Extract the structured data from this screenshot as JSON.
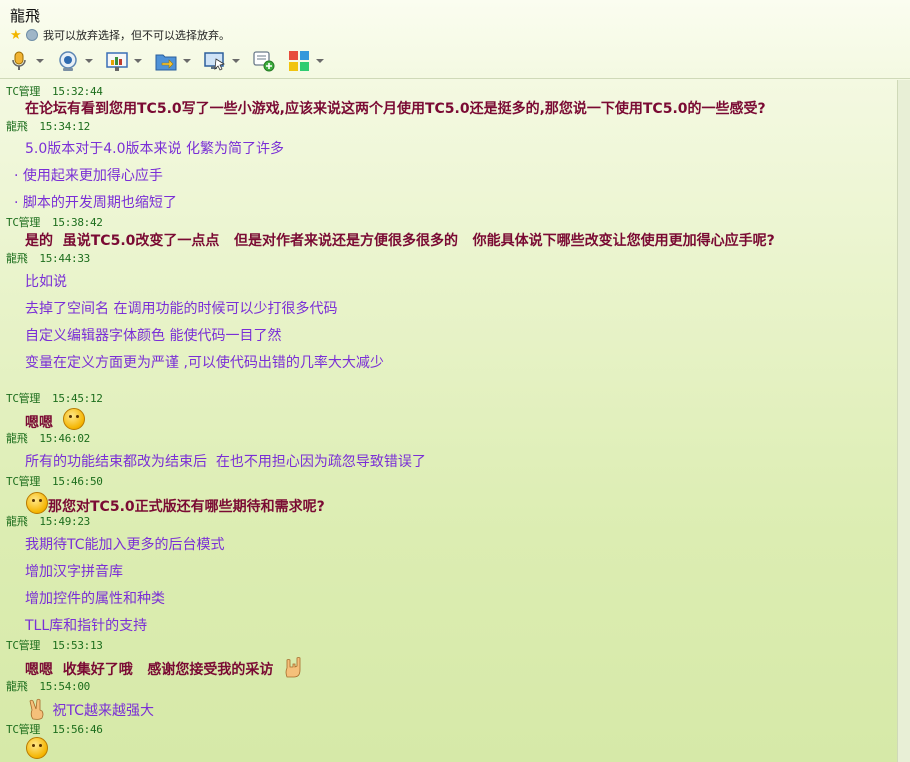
{
  "window": {
    "contact_name": "龍飛",
    "signature": "我可以放弃选择，但不可以选择放弃。"
  },
  "toolbar": {
    "items": [
      {
        "icon": "microphone-icon",
        "name": "voice"
      },
      {
        "icon": "webcam-icon",
        "name": "video"
      },
      {
        "icon": "presentation-icon",
        "name": "share-screen"
      },
      {
        "icon": "folder-transfer-icon",
        "name": "send-file"
      },
      {
        "icon": "remote-assist-icon",
        "name": "remote-assist"
      },
      {
        "icon": "message-add-icon",
        "name": "sms"
      },
      {
        "icon": "apps-grid-icon",
        "name": "apps"
      }
    ]
  },
  "messages": [
    {
      "sender": "TC管理",
      "time": "15:32:44",
      "lines": [
        {
          "text": "在论坛有看到您用TC5.0写了一些小游戏,应该来说这两个月使用TC5.0还是挺多的,那您说一下使用TC5.0的一些感受?"
        }
      ]
    },
    {
      "sender": "龍飛",
      "time": "15:34:12",
      "lines": [
        {
          "text": "5.0版本对于4.0版本来说 化繁为简了许多"
        },
        {
          "text": "使用起来更加得心应手"
        },
        {
          "text": "脚本的开发周期也缩短了"
        }
      ]
    },
    {
      "sender": "TC管理",
      "time": "15:38:42",
      "lines": [
        {
          "text": "是的  虽说TC5.0改变了一点点   但是对作者来说还是方便很多很多的   你能具体说下哪些改变让您使用更加得心应手呢?"
        }
      ]
    },
    {
      "sender": "龍飛",
      "time": "15:44:33",
      "lines": [
        {
          "text": "比如说"
        },
        {
          "text": "去掉了空间名 在调用功能的时候可以少打很多代码"
        },
        {
          "text": "自定义编辑器字体颜色 能使代码一目了然"
        },
        {
          "text": "变量在定义方面更为严谨 ,可以使代码出错的几率大大减少"
        }
      ]
    },
    {
      "sender": "TC管理",
      "time": "15:45:12",
      "lines": [
        {
          "text": "嗯嗯"
        }
      ]
    },
    {
      "sender": "龍飛",
      "time": "15:46:02",
      "lines": [
        {
          "text": "所有的功能结束都改为结束后  在也不用担心因为疏忽导致错误了"
        }
      ]
    },
    {
      "sender": "TC管理",
      "time": "15:46:50",
      "lines": [
        {
          "text": "那您对TC5.0正式版还有哪些期待和需求呢?"
        }
      ]
    },
    {
      "sender": "龍飛",
      "time": "15:49:23",
      "lines": [
        {
          "text": "我期待TC能加入更多的后台模式"
        },
        {
          "text": "增加汉字拼音库"
        },
        {
          "text": "增加控件的属性和种类"
        },
        {
          "text": "TLL库和指针的支持"
        }
      ]
    },
    {
      "sender": "TC管理",
      "time": "15:53:13",
      "lines": [
        {
          "text": "嗯嗯  收集好了哦   感谢您接受我的采访"
        }
      ]
    },
    {
      "sender": "龍飛",
      "time": "15:54:00",
      "lines": [
        {
          "text": "祝TC越来越强大"
        }
      ]
    },
    {
      "sender": "TC管理",
      "time": "15:56:46",
      "lines": []
    }
  ]
}
